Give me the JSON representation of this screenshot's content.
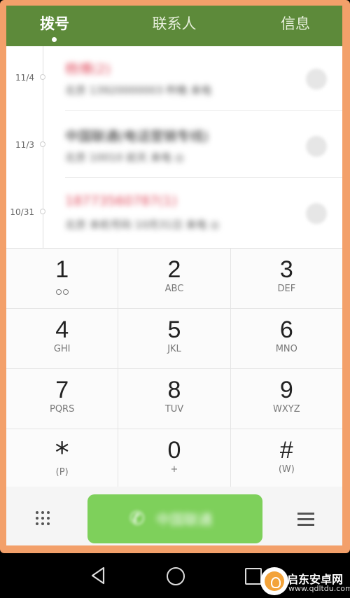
{
  "tabs": [
    {
      "label": "拨号",
      "active": true
    },
    {
      "label": "联系人",
      "active": false
    },
    {
      "label": "信息",
      "active": false
    }
  ],
  "call_log": [
    {
      "date": "11/4",
      "name": "杨博(2)",
      "name_color": "#e04a5c",
      "detail": "北京 13920000003 昨晚 来电",
      "info_icon": "info-icon"
    },
    {
      "date": "11/3",
      "name": "中国联通(电话营销专线)",
      "name_color": "#222222",
      "detail": "北京 10010 前天 来电 ◎",
      "info_icon": "info-icon"
    },
    {
      "date": "10/31",
      "name": "18773560787(1)",
      "name_color": "#e04a5c",
      "detail": "北京 本机号码 10月31日 来电 ◎",
      "info_icon": "info-icon"
    }
  ],
  "keypad": {
    "rows": [
      [
        {
          "digit": "1",
          "letters": "",
          "icon": "voicemail-icon"
        },
        {
          "digit": "2",
          "letters": "ABC"
        },
        {
          "digit": "3",
          "letters": "DEF"
        }
      ],
      [
        {
          "digit": "4",
          "letters": "GHI"
        },
        {
          "digit": "5",
          "letters": "JKL"
        },
        {
          "digit": "6",
          "letters": "MNO"
        }
      ],
      [
        {
          "digit": "7",
          "letters": "PQRS"
        },
        {
          "digit": "8",
          "letters": "TUV"
        },
        {
          "digit": "9",
          "letters": "WXYZ"
        }
      ],
      [
        {
          "digit": "*",
          "letters": "(P)"
        },
        {
          "digit": "0",
          "letters": "+"
        },
        {
          "digit": "#",
          "letters": "(W)"
        }
      ]
    ]
  },
  "bottom_bar": {
    "keypad_toggle_icon": "dialpad-grid-icon",
    "call_button_label": "中国联通",
    "call_icon": "phone-icon",
    "menu_icon": "hamburger-menu-icon",
    "call_button_color": "#7ed05b"
  },
  "nav_bar": {
    "back_icon": "back-triangle-icon",
    "home_icon": "home-circle-icon",
    "recent_icon": "recent-apps-square-icon"
  },
  "watermark": {
    "title": "启东安卓网",
    "url": "www.qdltdu.com"
  },
  "colors": {
    "header": "#5d8a3a",
    "frame": "#f3a06a",
    "missed_call": "#e04a5c"
  }
}
